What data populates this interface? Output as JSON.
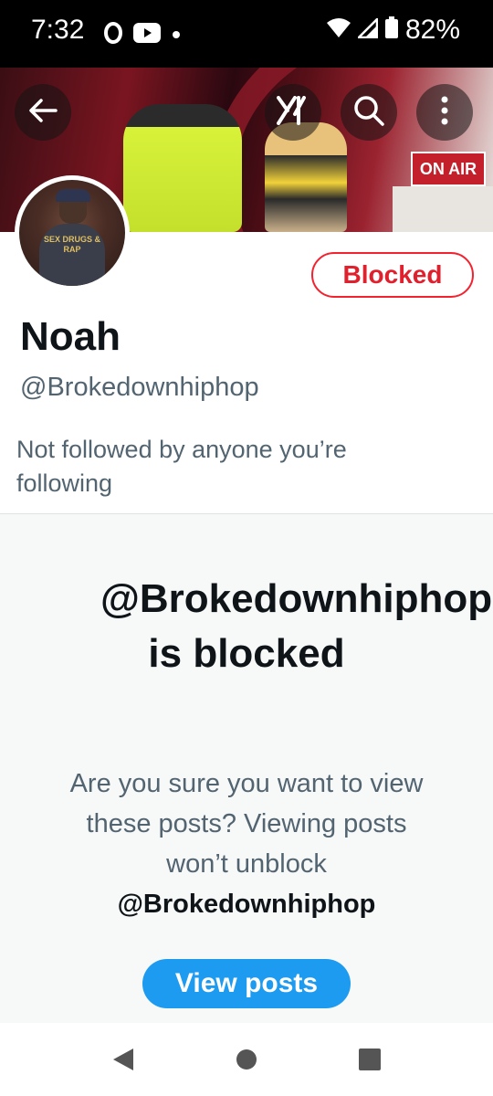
{
  "status_bar": {
    "time": "7:32",
    "battery": "82%",
    "left_icons": [
      "opera-icon",
      "youtube-icon",
      "dot-icon"
    ],
    "right_icons": [
      "wifi-icon",
      "signal-icon",
      "battery-icon"
    ]
  },
  "toolbar": {
    "back_icon": "back-arrow-icon",
    "grok_icon": "grok-icon",
    "search_icon": "search-icon",
    "more_icon": "more-vertical-icon"
  },
  "banner": {
    "sign_text": "ON AIR"
  },
  "profile": {
    "avatar_shirt_text": "SEX DRUGS & RAP",
    "blocked_label": "Blocked",
    "display_name": "Noah",
    "handle": "@Brokedownhiphop",
    "followed_by": "Not followed by anyone you’re following"
  },
  "blocked_notice": {
    "title": "@Brokedownhiphop is blocked",
    "description": "Are you sure you want to view these posts? Viewing posts won’t unblock",
    "description_handle": "@Brokedownhiphop",
    "button_label": "View posts"
  },
  "colors": {
    "accent": "#1d9bf0",
    "blocked_red": "#f4212e",
    "text_primary": "#0f1419",
    "text_secondary": "#536471"
  },
  "nav_bar": {
    "icons": [
      "back-triangle-icon",
      "home-circle-icon",
      "recents-square-icon"
    ]
  }
}
